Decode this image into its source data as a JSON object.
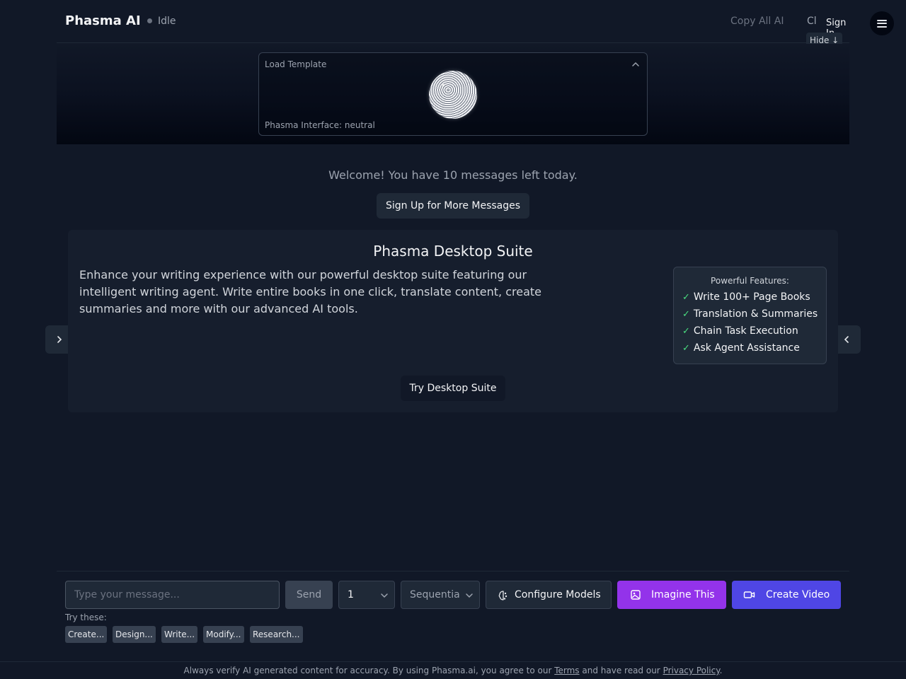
{
  "header": {
    "brand": "Phasma AI",
    "status": "Idle",
    "copy_all": "Copy All AI",
    "clear_partial": "Cl",
    "sign_in": "Sign In",
    "hide": "Hide ↓",
    "menu_icon": "hamburger-menu-icon"
  },
  "template": {
    "title": "Load Template",
    "status": "Phasma Interface: neutral"
  },
  "welcome": {
    "message": "Welcome! You have 10 messages left today.",
    "signup_button": "Sign Up for More Messages"
  },
  "promo": {
    "title": "Phasma Desktop Suite",
    "description": "Enhance your writing experience with our powerful desktop suite featuring our intelligent writing agent. Write entire books in one click, translate content, create summaries and more with our advanced AI tools.",
    "features_title": "Powerful Features:",
    "check_glyph": "✓",
    "features": [
      "Write 100+ Page Books",
      "Translation & Summaries",
      "Chain Task Execution",
      "Ask Agent Assistance"
    ],
    "try_button": "Try Desktop Suite"
  },
  "composer": {
    "placeholder": "Type your message...",
    "send": "Send",
    "count_value": "1",
    "mode_value": "Sequential",
    "configure": "Configure Models",
    "imagine": "Imagine This",
    "video": "Create Video",
    "try_label": "Try these:",
    "chips": [
      "Create...",
      "Design...",
      "Write...",
      "Modify...",
      "Research..."
    ]
  },
  "footer": {
    "text_before": "Always verify AI generated content for accuracy. By using Phasma.ai, you agree to our ",
    "terms": "Terms",
    "text_middle": " and have read our ",
    "privacy": "Privacy Policy",
    "text_after": "."
  },
  "colors": {
    "background": "#111827",
    "imagine_accent": "#9333ea",
    "video_accent": "#4f46e5",
    "check": "#4ade80"
  }
}
